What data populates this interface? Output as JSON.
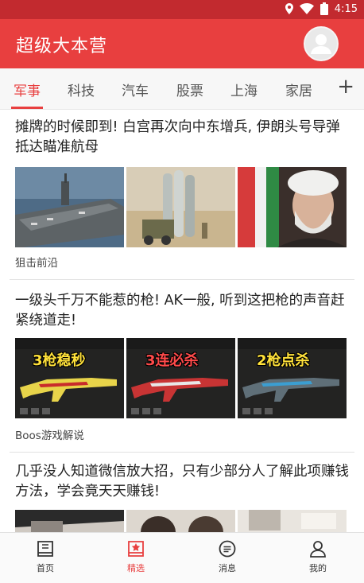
{
  "status_bar": {
    "time": "4:15"
  },
  "app_bar": {
    "title": "超级大本营"
  },
  "tabs": [
    {
      "label": "军事",
      "active": true
    },
    {
      "label": "科技"
    },
    {
      "label": "汽车"
    },
    {
      "label": "股票"
    },
    {
      "label": "上海"
    },
    {
      "label": "家居"
    }
  ],
  "tab_add_label": "+",
  "articles": [
    {
      "headline": "摊牌的时候即到! 白宫再次向中东增兵, 伊朗头号导弹抵达瞄准航母",
      "source": "狙击前沿"
    },
    {
      "headline": "一级头千万不能惹的枪! AK一般, 听到这把枪的声音赶紧绕道走!",
      "source": "Boos游戏解说",
      "thumb_captions": [
        "3枪稳秒",
        "3连必杀",
        "2枪点杀"
      ]
    },
    {
      "headline": "几乎没人知道微信放大招，只有少部分人了解此项赚钱方法，学会竟天天赚钱!",
      "source": ""
    }
  ],
  "bottom_nav": [
    {
      "label": "首页",
      "icon": "home-icon"
    },
    {
      "label": "精选",
      "icon": "featured-icon",
      "active": true
    },
    {
      "label": "消息",
      "icon": "message-icon"
    },
    {
      "label": "我的",
      "icon": "profile-icon"
    }
  ],
  "colors": {
    "accent": "#e83f3f",
    "statusbar": "#c22a2f"
  }
}
